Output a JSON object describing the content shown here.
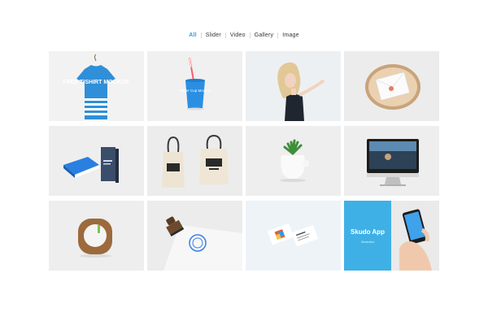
{
  "filters": [
    {
      "label": "All",
      "active": true
    },
    {
      "label": "Slider",
      "active": false
    },
    {
      "label": "Video",
      "active": false
    },
    {
      "label": "Gallery",
      "active": false
    },
    {
      "label": "Image",
      "active": false
    }
  ],
  "accent": "#2a9fd8",
  "portfolio": {
    "tshirt_text": "FREE T-SHIRT MOCKUP",
    "cup_text": "Paper Cup Mockup",
    "app_title": "Skudo App",
    "app_subtitle": "Illustrator"
  }
}
